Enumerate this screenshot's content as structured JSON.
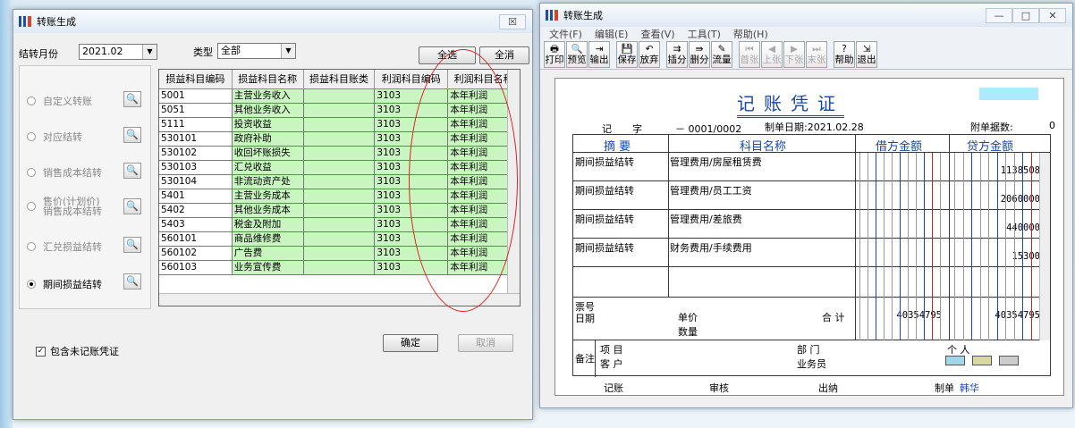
{
  "left_window": {
    "title": "转账生成",
    "close": "☒",
    "month_label": "结转月份",
    "month_value": "2021.02",
    "type_label": "类型",
    "type_value": "全部",
    "select_all": "全选",
    "clear_all": "全消",
    "options": [
      {
        "label": "自定义转账",
        "selected": false
      },
      {
        "label": "对应结转",
        "selected": false
      },
      {
        "label": "销售成本结转",
        "selected": false
      },
      {
        "label": "售价(计划价)",
        "label2": "销售成本结转",
        "selected": false
      },
      {
        "label": "汇兑损益结转",
        "selected": false
      },
      {
        "label": "期间损益结转",
        "selected": true
      }
    ],
    "columns": [
      "损益科目编码",
      "损益科目名称",
      "损益科目账类",
      "利润科目编码",
      "利润科目名称"
    ],
    "rows": [
      [
        "5001",
        "主营业务收入",
        "",
        "3103",
        "本年利润"
      ],
      [
        "5051",
        "其他业务收入",
        "",
        "3103",
        "本年利润"
      ],
      [
        "5111",
        "投资收益",
        "",
        "3103",
        "本年利润"
      ],
      [
        "530101",
        "政府补助",
        "",
        "3103",
        "本年利润"
      ],
      [
        "530102",
        "收回坏账损失",
        "",
        "3103",
        "本年利润"
      ],
      [
        "530103",
        "汇兑收益",
        "",
        "3103",
        "本年利润"
      ],
      [
        "530104",
        "非流动资产处",
        "",
        "3103",
        "本年利润"
      ],
      [
        "5401",
        "主营业务成本",
        "",
        "3103",
        "本年利润"
      ],
      [
        "5402",
        "其他业务成本",
        "",
        "3103",
        "本年利润"
      ],
      [
        "5403",
        "税金及附加",
        "",
        "3103",
        "本年利润"
      ],
      [
        "560101",
        "商品维修费",
        "",
        "3103",
        "本年利润"
      ],
      [
        "560102",
        "广告费",
        "",
        "3103",
        "本年利润"
      ],
      [
        "560103",
        "业务宣传费",
        "",
        "3103",
        "本年利润"
      ]
    ],
    "include_label": "包含未记账凭证",
    "ok": "确定",
    "cancel": "取消"
  },
  "right_window": {
    "title": "转账生成",
    "menu": [
      "文件(F)",
      "编辑(E)",
      "查看(V)",
      "工具(T)",
      "帮助(H)"
    ],
    "toolbar": [
      "打印",
      "预览",
      "输出",
      "保存",
      "放弃",
      "插分",
      "删分",
      "流量",
      "首张",
      "上张",
      "下张",
      "末张",
      "帮助",
      "退出"
    ],
    "voucher_title": "记账凭证",
    "voucher_kind": "记",
    "zi": "字",
    "voucher_no": "－ 0001/0002",
    "date_label": "制单日期:2021.02.28",
    "attach_label": "附单据数:",
    "attach_value": "0",
    "headers": [
      "摘 要",
      "科目名称",
      "借方金额",
      "贷方金额"
    ],
    "entries": [
      {
        "summary": "期间损益结转",
        "account": "管理费用/房屋租赁费",
        "debit": "",
        "credit": "1138508"
      },
      {
        "summary": "期间损益结转",
        "account": "管理费用/员工工资",
        "debit": "",
        "credit": "2060000"
      },
      {
        "summary": "期间损益结转",
        "account": "管理费用/差旅费",
        "debit": "",
        "credit": "440000"
      },
      {
        "summary": "期间损益结转",
        "account": "财务费用/手续费用",
        "debit": "",
        "credit": "15300"
      }
    ],
    "ticket": "票号",
    "date": "日期",
    "unit_price": "单价",
    "qty": "数量",
    "total": "合 计",
    "total_debit": "40354795",
    "total_credit": "40354795",
    "remark": "备注",
    "project": "项  目",
    "dept": "部  门",
    "person": "个  人",
    "customer": "客  户",
    "salesman": "业务员",
    "footer": {
      "post": "记账",
      "audit": "审核",
      "cashier": "出纳",
      "maker": "制单",
      "maker_name": "韩华"
    }
  }
}
